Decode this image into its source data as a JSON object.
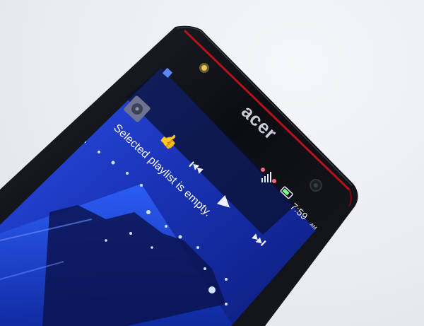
{
  "phone": {
    "brand": "acer"
  },
  "status_bar": {
    "time": "7:59",
    "ampm": "AM"
  },
  "music_widget": {
    "message": "Selected playlist is empty.",
    "controls": [
      {
        "name": "thumbs-up-icon",
        "symbol": "👍"
      },
      {
        "name": "previous-track-icon",
        "symbol": "⏮"
      },
      {
        "name": "play-icon",
        "symbol": "▶"
      },
      {
        "name": "next-track-icon",
        "symbol": "⏭"
      }
    ]
  },
  "colors": {
    "bezel": "#0d0f14",
    "accent_red": "#b5121b",
    "screen_blue": "#1e3fd6",
    "bg": "#e9ecf2"
  }
}
